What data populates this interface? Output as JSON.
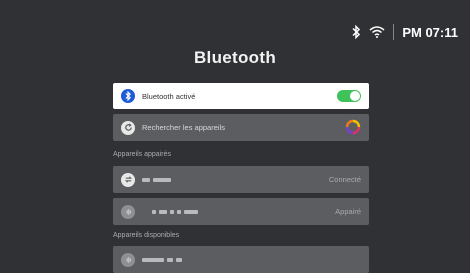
{
  "status_bar": {
    "bluetooth_icon": "bluetooth-icon",
    "wifi_icon": "wifi-icon",
    "time": "PM 07:11"
  },
  "title": "Bluetooth",
  "bluetooth_toggle": {
    "label": "Bluetooth activé",
    "icon": "bluetooth-icon",
    "enabled": true,
    "accent": "#3fc25a",
    "icon_color": "#1e5bd8"
  },
  "scan": {
    "label": "Rechercher les appareils",
    "icon": "refresh-icon",
    "spinner_icon": "loading-spinner-icon"
  },
  "paired_section": {
    "label": "Appareils appairés",
    "devices": [
      {
        "icon": "link-icon",
        "status": "Connecté"
      },
      {
        "icon": "audio-device-icon",
        "status": "Appairé"
      }
    ]
  },
  "available_section": {
    "label": "Appareils disponibles",
    "devices": [
      {
        "icon": "audio-device-icon",
        "status": ""
      }
    ]
  }
}
